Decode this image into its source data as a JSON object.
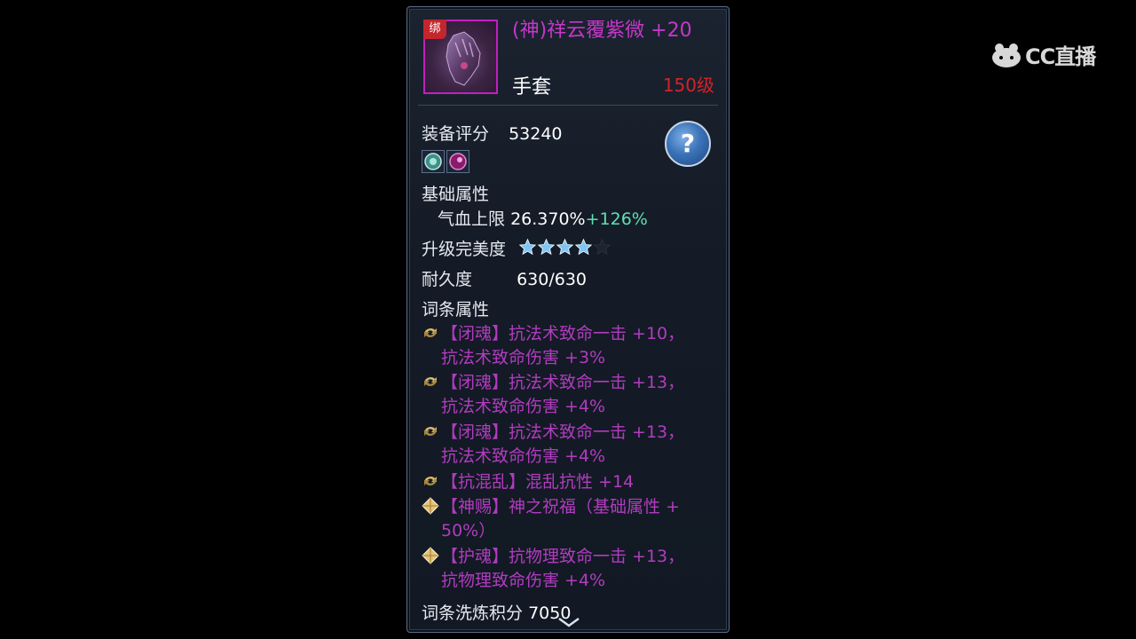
{
  "item": {
    "bind_badge": "绑",
    "name": "(神)祥云覆紫微 +20",
    "type": "手套",
    "level": "150级"
  },
  "stats": {
    "score_label": "装备评分",
    "score_value": "53240",
    "base_label": "基础属性",
    "base_stat_name": "气血上限",
    "base_stat_value": "26.370%",
    "base_stat_bonus": "+126%",
    "perfection_label": "升级完美度",
    "perfection_stars": 4,
    "perfection_max": 5,
    "durability_label": "耐久度",
    "durability_value": "630/630",
    "affix_label": "词条属性"
  },
  "affixes": [
    {
      "icon": "swirl-icon",
      "line1": "【闭魂】抗法术致命一击 +10，",
      "line2": "抗法术致命伤害 +3%"
    },
    {
      "icon": "swirl-icon",
      "line1": "【闭魂】抗法术致命一击 +13，",
      "line2": "抗法术致命伤害 +4%"
    },
    {
      "icon": "swirl-icon",
      "line1": "【闭魂】抗法术致命一击 +13，",
      "line2": "抗法术致命伤害 +4%"
    },
    {
      "icon": "swirl-icon",
      "line1": "【抗混乱】混乱抗性 +14",
      "line2": ""
    },
    {
      "icon": "diamond-icon",
      "line1": "【神赐】神之祝福（基础属性 +",
      "line2": "50%）"
    },
    {
      "icon": "diamond-icon",
      "line1": "【护魂】抗物理致命一击 +13，",
      "line2": "抗物理致命伤害 +4%"
    }
  ],
  "refine": {
    "label": "词条洗炼积分",
    "value": "7050"
  },
  "help": {
    "symbol": "?"
  },
  "watermark": {
    "text": "CC直播"
  },
  "colors": {
    "item_name": "#c438c8",
    "level": "#d2232a",
    "affix": "#b13cbf",
    "bonus": "#5fe0b2"
  }
}
